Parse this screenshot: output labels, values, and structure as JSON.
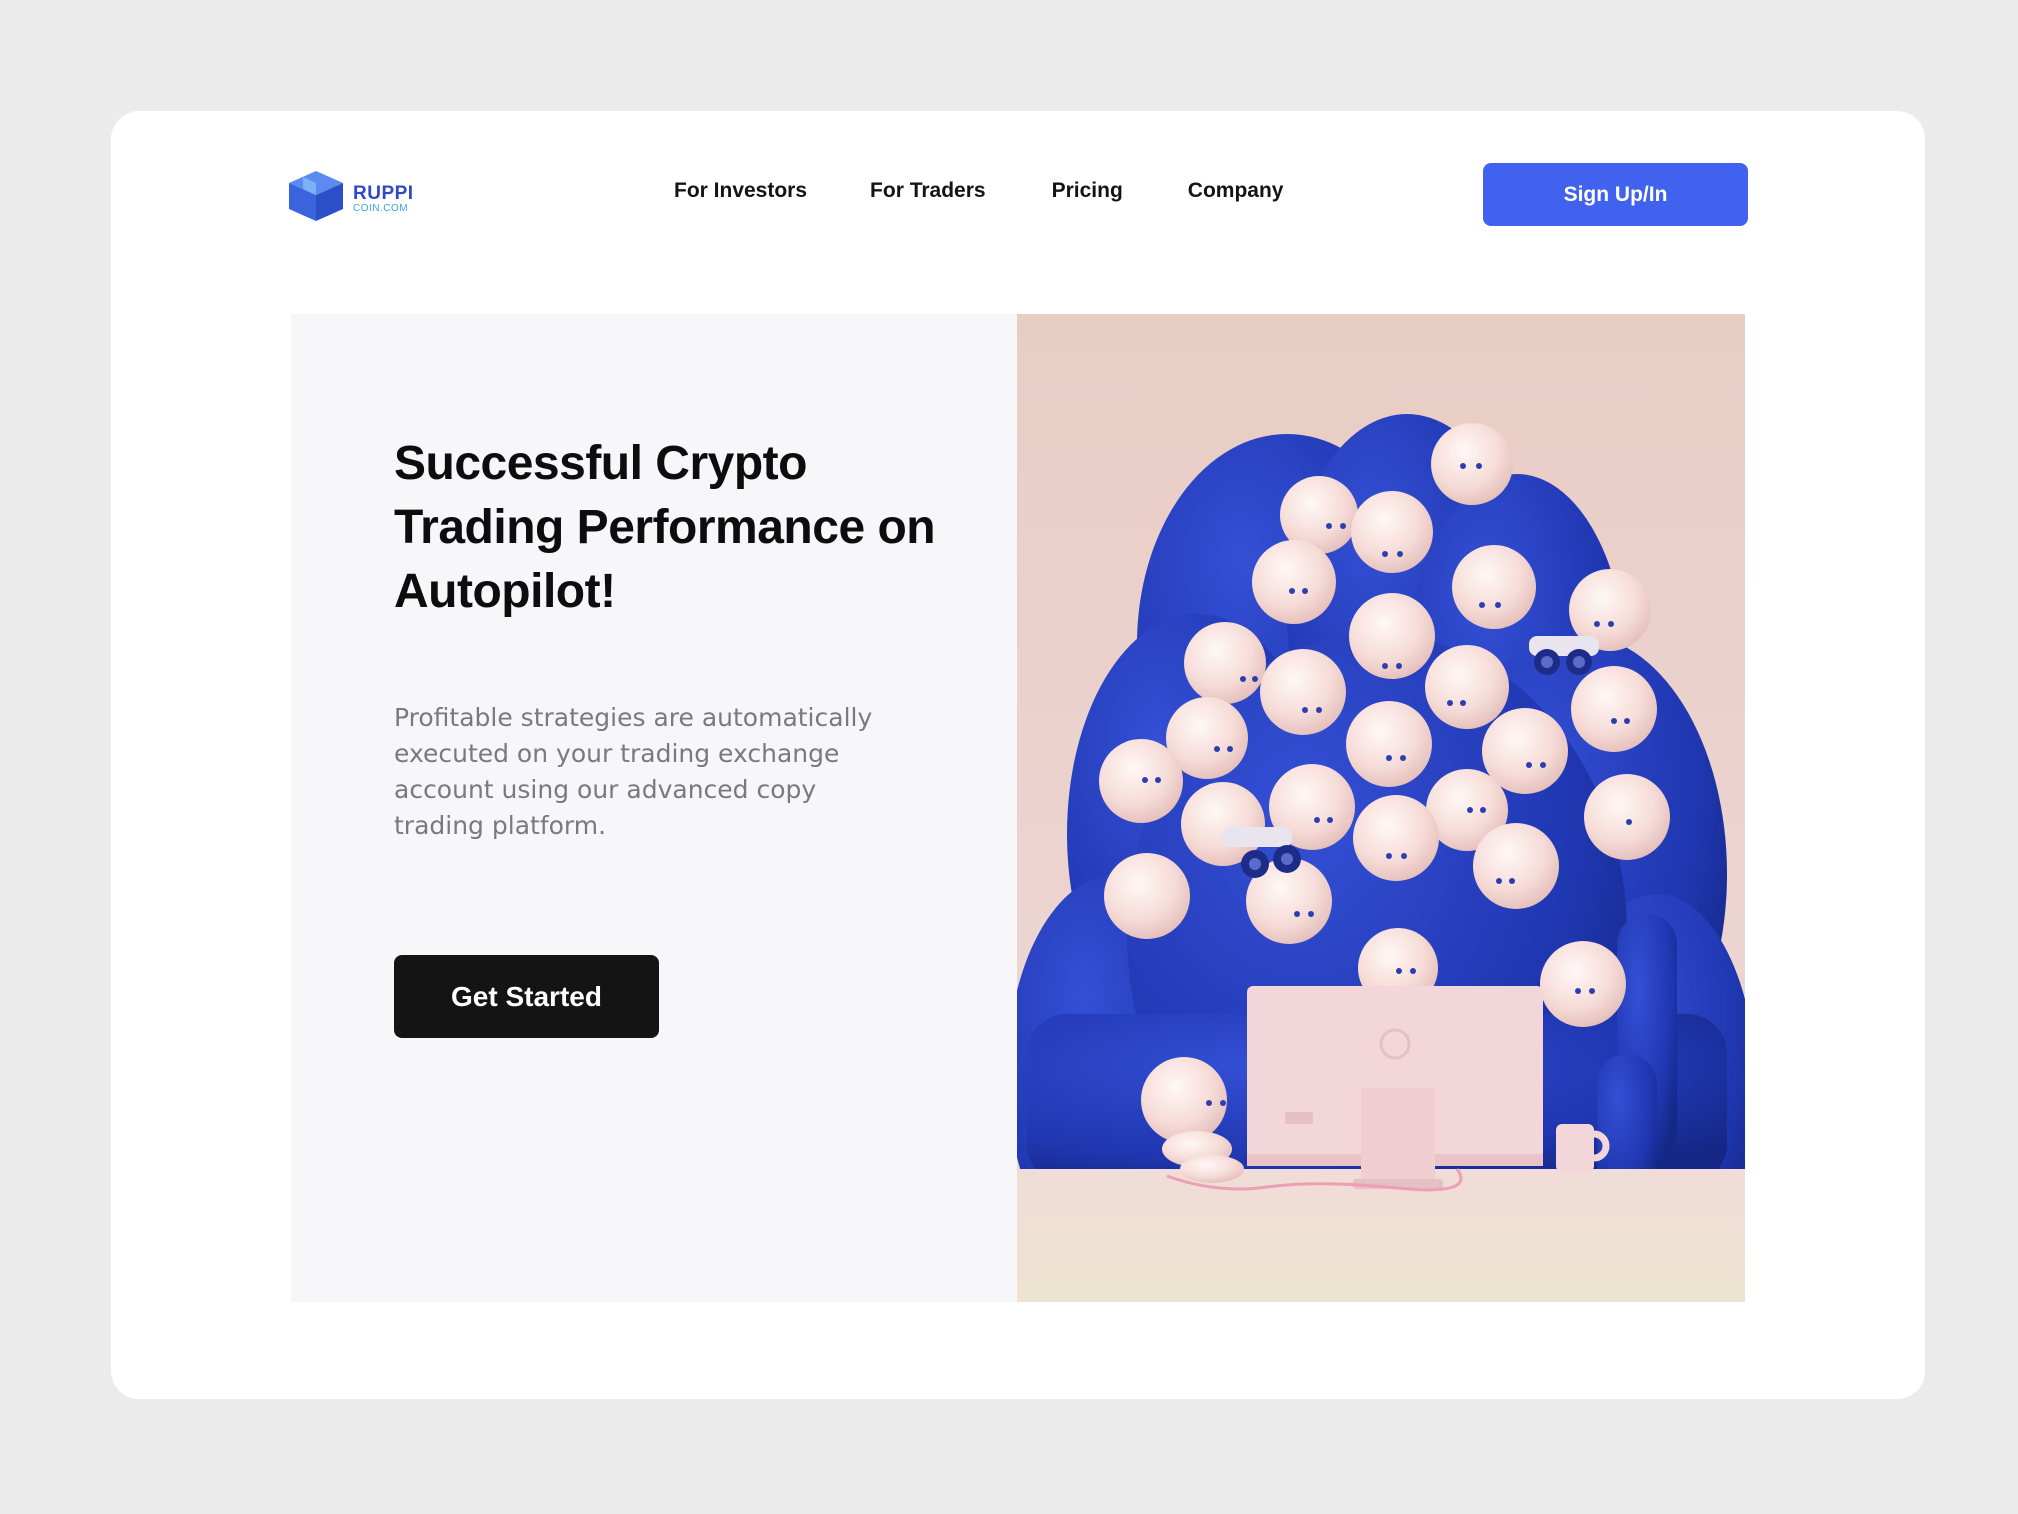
{
  "brand": {
    "name": "RUPPI",
    "domain": "COIN.COM",
    "colors": {
      "primary": "#2f47c9",
      "accent": "#3aa3e3"
    }
  },
  "nav": {
    "items": [
      {
        "label": "For Investors"
      },
      {
        "label": "For Traders"
      },
      {
        "label": "Pricing"
      },
      {
        "label": "Company"
      }
    ]
  },
  "header": {
    "signup_label": "Sign Up/In",
    "signup_color": "#4162ee"
  },
  "hero": {
    "title": "Successful Crypto Trading Performance on Autopilot!",
    "description": "Profitable strategies are automatically executed on your trading exchange account using our advanced copy trading platform.",
    "cta_label": "Get Started",
    "cta_color": "#141414",
    "illustration": "crowd-of-characters-watching-monitor"
  }
}
